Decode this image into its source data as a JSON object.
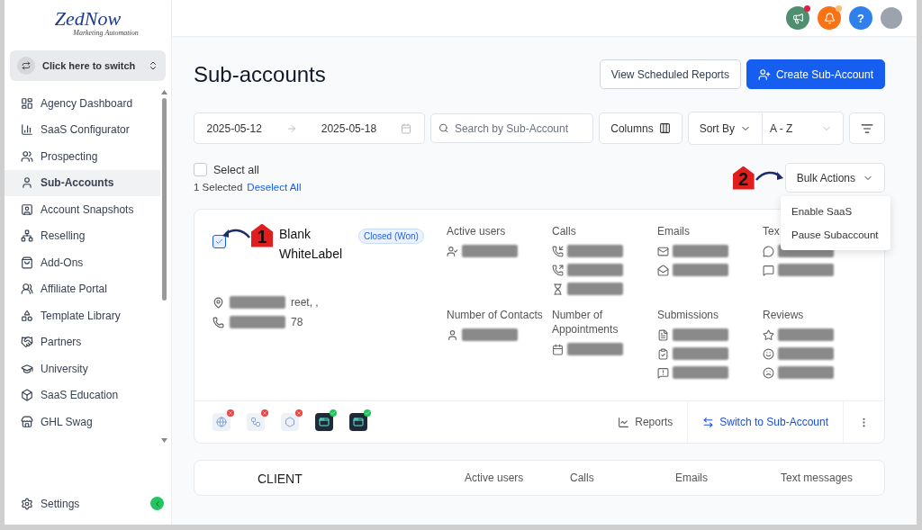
{
  "logo": {
    "brand": "ZedNow",
    "tagline": "Marketing Automation"
  },
  "switcher": {
    "label": "Click here to switch"
  },
  "sidebar": {
    "items": [
      {
        "label": "Agency Dashboard",
        "selected": false
      },
      {
        "label": "SaaS Configurator",
        "selected": false
      },
      {
        "label": "Prospecting",
        "selected": false
      },
      {
        "label": "Sub-Accounts",
        "selected": true
      },
      {
        "label": "Account Snapshots",
        "selected": false
      },
      {
        "label": "Reselling",
        "selected": false
      },
      {
        "label": "Add-Ons",
        "selected": false
      },
      {
        "label": "Affiliate Portal",
        "selected": false
      },
      {
        "label": "Template Library",
        "selected": false
      },
      {
        "label": "Partners",
        "selected": false
      },
      {
        "label": "University",
        "selected": false
      },
      {
        "label": "SaaS Education",
        "selected": false
      },
      {
        "label": "GHL Swag",
        "selected": false
      }
    ],
    "settings": "Settings"
  },
  "topbar": {
    "help": "?"
  },
  "page": {
    "title": "Sub-accounts",
    "buttons": [
      {
        "label": "View Scheduled Reports",
        "kind": "outline"
      },
      {
        "label": "Create Sub-Account",
        "kind": "primary"
      }
    ]
  },
  "filters": {
    "date_start": "2025-05-12",
    "date_end": "2025-05-18",
    "search": {
      "placeholder": "Search by Sub-Account"
    },
    "columns": "Columns",
    "sort_by": "Sort By",
    "sort_value": "A - Z"
  },
  "selection": {
    "select_all": {
      "label": "Select all",
      "checked": false
    },
    "count": "1 Selected",
    "deselect": "Deselect All"
  },
  "bulk_actions": {
    "label": "Bulk Actions",
    "annotation": "2",
    "menu": [
      "Enable SaaS",
      "Pause Subaccount"
    ]
  },
  "card": {
    "checked": true,
    "annotation": "1",
    "name": "Blank WhiteLabel",
    "status": "Closed (Won)",
    "address": "reet, ,",
    "phone": "78",
    "stats": [
      {
        "label": "Active users"
      },
      {
        "label": "Calls"
      },
      {
        "label": "Emails"
      },
      {
        "label": "Tex"
      },
      {
        "label": "Number of Contacts"
      },
      {
        "label": "Number of Appointments"
      },
      {
        "label": "Submissions"
      },
      {
        "label": "Reviews"
      }
    ],
    "integrations": [
      {
        "connected": false
      },
      {
        "connected": false
      },
      {
        "connected": false
      },
      {
        "connected": true
      },
      {
        "connected": true
      }
    ],
    "reports": "Reports",
    "switch": "Switch to Sub-Account"
  },
  "next_card": {
    "name": "CLIENT",
    "columns": [
      "Active users",
      "Calls",
      "Emails",
      "Text messages"
    ]
  }
}
